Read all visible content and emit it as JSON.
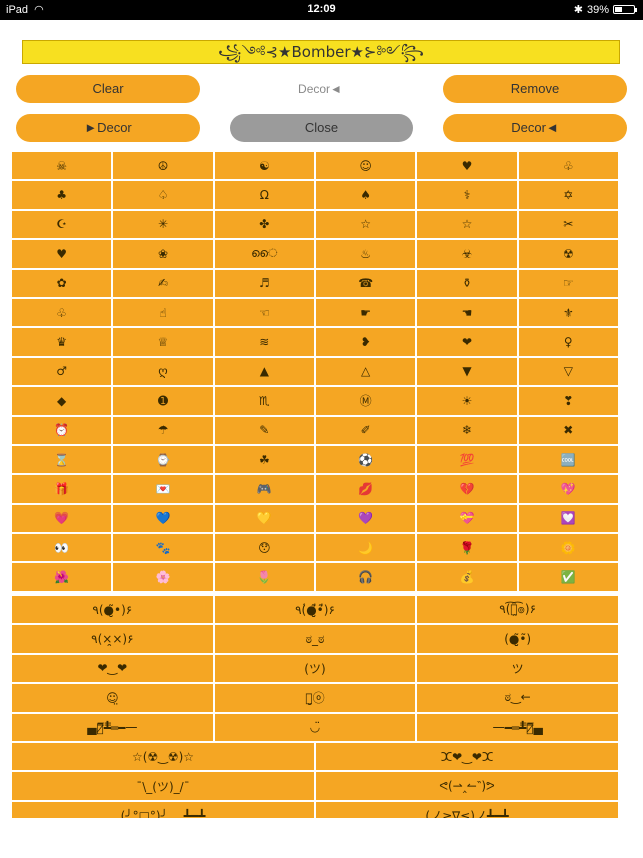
{
  "status_bar": {
    "device": "iPad",
    "time": "12:09",
    "battery": "39%",
    "battery_level": 0.39
  },
  "title": "ᘛ⁐̤ᕐᐷ꧁ ༺⊰★Bomber★⊱༻ ꧂ᘛ⁐̤ᕐᐷ",
  "title_display": "꧁༺⊰★Bomber★⊱༻꧂",
  "buttons": {
    "clear": "Clear",
    "decor_label": "Decor◄",
    "remove": "Remove",
    "decor_left": "►Decor",
    "close": "Close",
    "decor_right": "Decor◄"
  },
  "symbols": [
    "☠",
    "☮",
    "☯",
    "☺",
    "♥",
    "♧",
    "♣",
    "♤",
    "Ω",
    "♠",
    "⚕",
    "✡",
    "☪",
    "✳",
    "✤",
    "☆",
    "☆",
    "✂",
    "♥",
    "❀",
    "ൈ",
    "♨",
    "☣",
    "☢",
    "✿",
    "✍",
    "♬",
    "☎",
    "⚱",
    "☞",
    "♧",
    "☝",
    "☜",
    "☛",
    "☚",
    "⚜",
    "♛",
    "♕",
    "≋",
    "❥",
    "❤",
    "♀",
    "♂",
    "ღ",
    "▲",
    "△",
    "▼",
    "▽",
    "◆",
    "➊",
    "♏",
    "Ⓜ",
    "☀",
    "❣",
    "⏰",
    "☂",
    "✎",
    "✐",
    "❄",
    "✖",
    "⌛",
    "⌚",
    "☘",
    "⚽",
    "💯",
    "🆒",
    "🎁",
    "💌",
    "🎮",
    "💋",
    "💔",
    "💖",
    "💗",
    "💙",
    "💛",
    "💜",
    "💝",
    "💟",
    "👀",
    "🐾",
    "😯",
    "🌙",
    "🌹",
    "🌼",
    "🌺",
    "🌸",
    "🌷",
    "🎧",
    "💰",
    "✅"
  ],
  "emoticons_three": [
    "٩(●̮̃•)۶",
    "٩(̾●̮̮̃̾•̃̾)۶",
    "٩(͡๏̯͡๏)۶",
    "٩(×̯×)۶",
    "ಠ_ಠ",
    "(●̮̮̃•̃)",
    "❤‿❤",
    "(ツ)",
    "ツ",
    "☺̤",
    "ⓞ̤̮ⓞ",
    "ಠ‿←",
    "▄︻̷̿┻̿═━一",
    "◡̈",
    "一━═┻̿︻̷̿▄"
  ],
  "emoticons_two": [
    "☆(☢‿☢)☆",
    "ⵋ❤‿❤ⵋ",
    "¯\\_(ツ)_/¯",
    "ᕙ(⇀‸↼‶)ᕗ",
    "(╯°□°)╯︵ ┻━┻",
    "(ノ≥∇≤)ノ┻━┻"
  ]
}
